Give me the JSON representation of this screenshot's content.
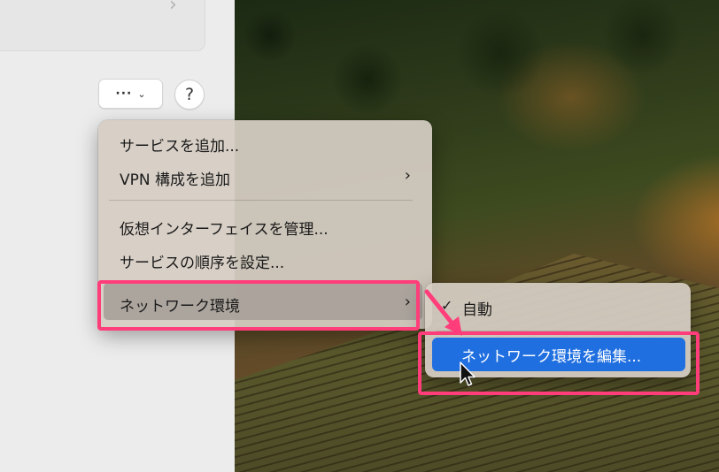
{
  "toolbar": {
    "more_label": "···",
    "more_chevron_icon": "chevron-down-icon",
    "help_label": "?"
  },
  "menu": {
    "items": [
      {
        "label": "サービスを追加..."
      },
      {
        "label": "VPN 構成を追加",
        "has_submenu": true
      },
      {
        "label": "仮想インターフェイスを管理..."
      },
      {
        "label": "サービスの順序を設定..."
      },
      {
        "label": "ネットワーク環境",
        "has_submenu": true,
        "highlighted": true
      }
    ]
  },
  "submenu": {
    "checked_item": "自動",
    "active_item": "ネットワーク環境を編集..."
  },
  "colors": {
    "annotation": "#ff3d7a",
    "selection": "#1f6fe0"
  }
}
